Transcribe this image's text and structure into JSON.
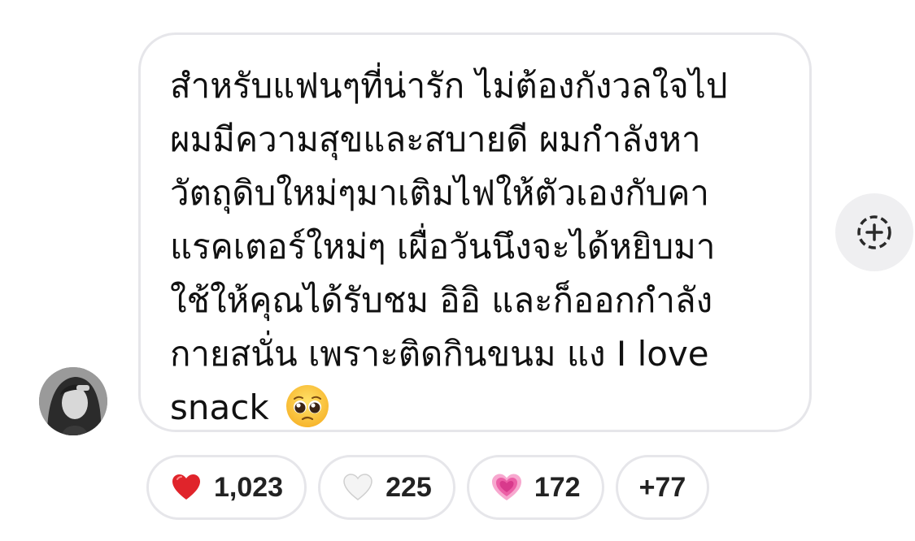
{
  "message": {
    "lines": [
      "สำหรับแฟนๆที่น่ารัก ไม่ต้องกังวลใจไป",
      "ผมมีความสุขและสบายดี ผมกำลังหา",
      "วัตถุดิบใหม่ๆมาเติมไฟให้ตัวเองกับคา",
      "แรคเตอร์ใหม่ๆ เผื่อวันนึงจะได้หยิบมา",
      "ใช้ให้คุณได้รับชม อิอิ และก็ออกกำลัง",
      "กายสนั่น เพราะติดกินขนม แง  I love",
      "snack"
    ],
    "trailing_emoji": "pleading-face-emoji"
  },
  "add_reaction": {
    "icon": "add-reaction-icon"
  },
  "reactions": [
    {
      "emoji": "red-heart",
      "count": "1,023",
      "color": "#e0242b"
    },
    {
      "emoji": "white-heart",
      "count": "225",
      "color": "#f2f2f2"
    },
    {
      "emoji": "growing-heart",
      "count": "172",
      "color": "#f472b6"
    }
  ],
  "more_reactions": {
    "label": "+77"
  }
}
